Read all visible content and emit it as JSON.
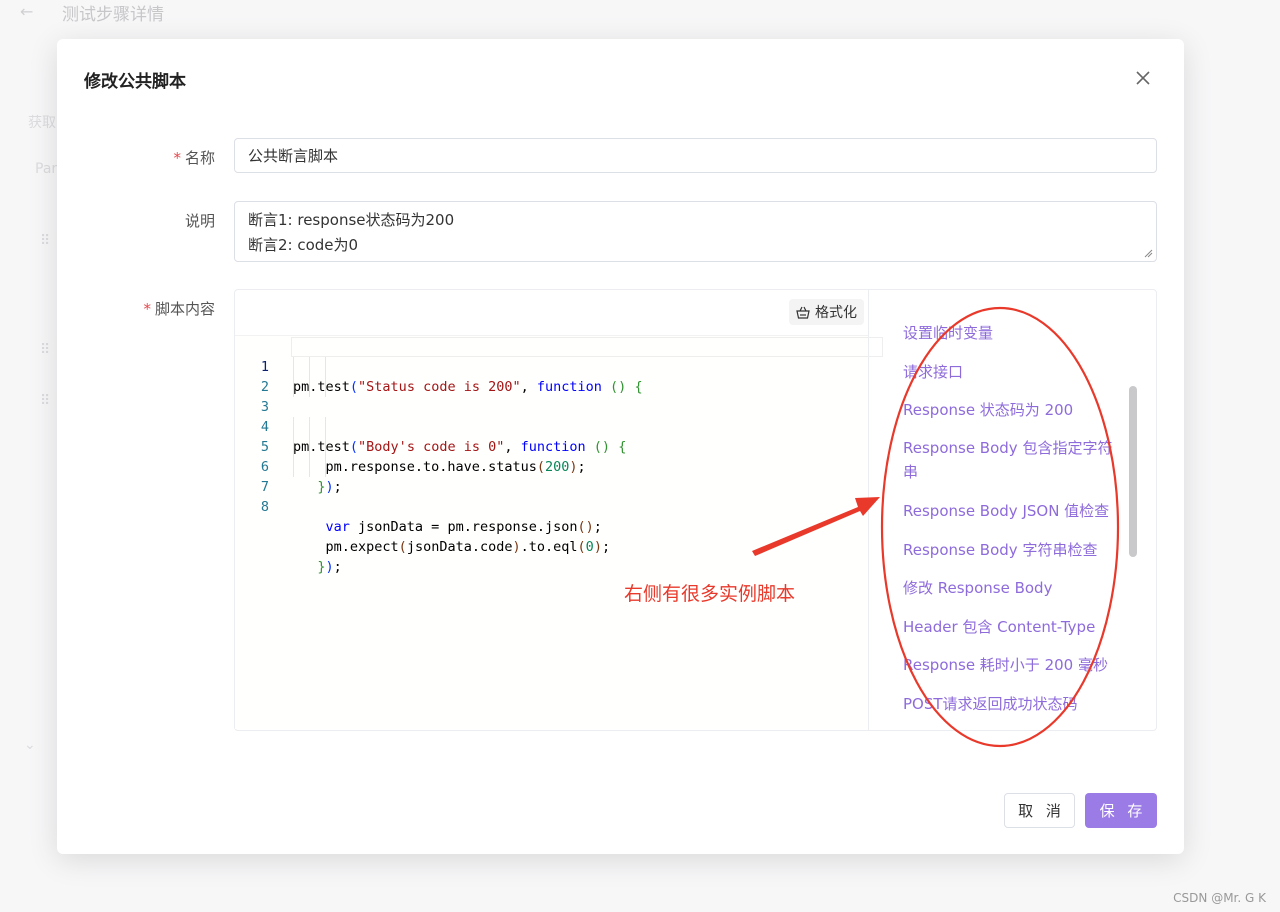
{
  "background": {
    "page_title": "测试步骤详情",
    "faint_1": "获取",
    "faint_2": "Par"
  },
  "modal": {
    "title": "修改公共脚本",
    "fields": {
      "name_label": "名称",
      "name_value": "公共断言脚本",
      "desc_label": "说明",
      "desc_lines": [
        "断言1: response状态码为200",
        "断言2: code为0"
      ],
      "script_label": "脚本内容"
    },
    "format_button": "格式化",
    "code_lines": [
      "pm.test(\"Status code is 200\", function () {",
      "    pm.response.to.have.status(200);",
      "});",
      "pm.test(\"Body's code is 0\", function () {",
      "    var jsonData = pm.response.json();",
      "    pm.expect(jsonData.code).to.eql(0);",
      "});",
      ""
    ],
    "line_numbers": [
      "1",
      "2",
      "3",
      "4",
      "5",
      "6",
      "7",
      "8"
    ],
    "snippets": [
      "设置临时变量",
      "请求接口",
      "Response 状态码为 200",
      "Response Body 包含指定字符串",
      "Response Body JSON 值检查",
      "Response Body 字符串检查",
      "修改 Response Body",
      "Header 包含 Content-Type",
      "Response 耗时小于 200 毫秒",
      "POST请求返回成功状态码"
    ],
    "cancel_label": "取 消",
    "save_label": "保 存"
  },
  "annotation": {
    "text": "右侧有很多实例脚本",
    "color": "#e8392b"
  },
  "colors": {
    "accent": "#9b7be6",
    "snippet": "#8e6bdb",
    "required": "#e5484d"
  },
  "watermark": "CSDN @Mr. G K"
}
